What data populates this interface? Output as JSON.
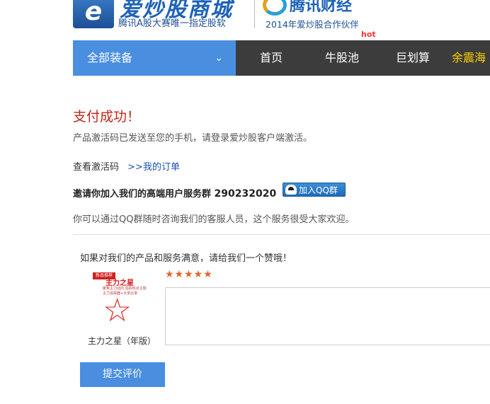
{
  "header": {
    "logo_mark": "e",
    "logo_title": "爱炒股商城",
    "logo_subtitle": "腾讯A股大赛唯一指定股软",
    "partner_title": "腾讯财经",
    "partner_subtitle": "2014年爱炒股合作伙伴"
  },
  "nav": {
    "all_equipment": "全部装备",
    "items": [
      {
        "label": "首页"
      },
      {
        "label": "牛股池",
        "badge": "hot"
      },
      {
        "label": "巨划算"
      },
      {
        "label": "余震海"
      }
    ]
  },
  "content": {
    "success_title": "支付成功！",
    "activation_message": "产品激活码已发送至您的手机，请登录爱炒股客户端激活。",
    "view_code_label": "查看激活码",
    "my_orders_link": ">>我的订单",
    "invite_text": "邀请你加入我们的高端用户服务群",
    "qq_group_number": "290232020",
    "join_qq_button": "加入QQ群",
    "qq_help_text": "你可以通过QQ群随时咨询我们的客服人员，这个服务很受大家欢迎。"
  },
  "review": {
    "prompt": "如果对我们的产品和服务满意，请给我们一个赞哦！",
    "product_badge": "新品推荐",
    "product_name": "主力之星",
    "product_desc_1": "聚焦主力动向 追踪热点主题",
    "product_desc_2": "主力追踪器+大单比率",
    "product_caption": "主力之星（年版）",
    "rating_stars": "★★★★★",
    "rating_value": 5,
    "rating_max": 5,
    "review_text_value": "",
    "submit_button": "提交评价"
  },
  "colors": {
    "brand_blue": "#4a8ee0",
    "nav_dark": "#3c3c3c",
    "success_red": "#c0261a",
    "star_orange": "#e8622a",
    "hot_red": "#ff3030",
    "nav_yellow": "#ffd200"
  }
}
